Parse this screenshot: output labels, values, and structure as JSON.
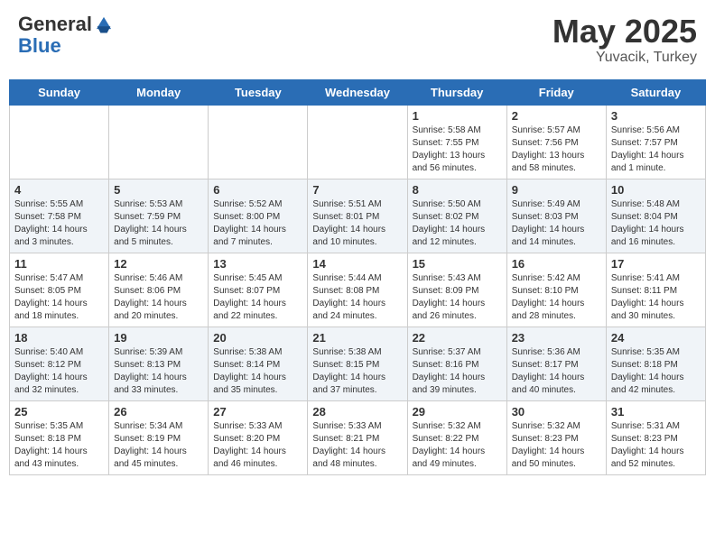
{
  "header": {
    "logo_general": "General",
    "logo_blue": "Blue",
    "month_year": "May 2025",
    "location": "Yuvacik, Turkey"
  },
  "weekdays": [
    "Sunday",
    "Monday",
    "Tuesday",
    "Wednesday",
    "Thursday",
    "Friday",
    "Saturday"
  ],
  "weeks": [
    [
      {
        "day": "",
        "info": ""
      },
      {
        "day": "",
        "info": ""
      },
      {
        "day": "",
        "info": ""
      },
      {
        "day": "",
        "info": ""
      },
      {
        "day": "1",
        "info": "Sunrise: 5:58 AM\nSunset: 7:55 PM\nDaylight: 13 hours\nand 56 minutes."
      },
      {
        "day": "2",
        "info": "Sunrise: 5:57 AM\nSunset: 7:56 PM\nDaylight: 13 hours\nand 58 minutes."
      },
      {
        "day": "3",
        "info": "Sunrise: 5:56 AM\nSunset: 7:57 PM\nDaylight: 14 hours\nand 1 minute."
      }
    ],
    [
      {
        "day": "4",
        "info": "Sunrise: 5:55 AM\nSunset: 7:58 PM\nDaylight: 14 hours\nand 3 minutes."
      },
      {
        "day": "5",
        "info": "Sunrise: 5:53 AM\nSunset: 7:59 PM\nDaylight: 14 hours\nand 5 minutes."
      },
      {
        "day": "6",
        "info": "Sunrise: 5:52 AM\nSunset: 8:00 PM\nDaylight: 14 hours\nand 7 minutes."
      },
      {
        "day": "7",
        "info": "Sunrise: 5:51 AM\nSunset: 8:01 PM\nDaylight: 14 hours\nand 10 minutes."
      },
      {
        "day": "8",
        "info": "Sunrise: 5:50 AM\nSunset: 8:02 PM\nDaylight: 14 hours\nand 12 minutes."
      },
      {
        "day": "9",
        "info": "Sunrise: 5:49 AM\nSunset: 8:03 PM\nDaylight: 14 hours\nand 14 minutes."
      },
      {
        "day": "10",
        "info": "Sunrise: 5:48 AM\nSunset: 8:04 PM\nDaylight: 14 hours\nand 16 minutes."
      }
    ],
    [
      {
        "day": "11",
        "info": "Sunrise: 5:47 AM\nSunset: 8:05 PM\nDaylight: 14 hours\nand 18 minutes."
      },
      {
        "day": "12",
        "info": "Sunrise: 5:46 AM\nSunset: 8:06 PM\nDaylight: 14 hours\nand 20 minutes."
      },
      {
        "day": "13",
        "info": "Sunrise: 5:45 AM\nSunset: 8:07 PM\nDaylight: 14 hours\nand 22 minutes."
      },
      {
        "day": "14",
        "info": "Sunrise: 5:44 AM\nSunset: 8:08 PM\nDaylight: 14 hours\nand 24 minutes."
      },
      {
        "day": "15",
        "info": "Sunrise: 5:43 AM\nSunset: 8:09 PM\nDaylight: 14 hours\nand 26 minutes."
      },
      {
        "day": "16",
        "info": "Sunrise: 5:42 AM\nSunset: 8:10 PM\nDaylight: 14 hours\nand 28 minutes."
      },
      {
        "day": "17",
        "info": "Sunrise: 5:41 AM\nSunset: 8:11 PM\nDaylight: 14 hours\nand 30 minutes."
      }
    ],
    [
      {
        "day": "18",
        "info": "Sunrise: 5:40 AM\nSunset: 8:12 PM\nDaylight: 14 hours\nand 32 minutes."
      },
      {
        "day": "19",
        "info": "Sunrise: 5:39 AM\nSunset: 8:13 PM\nDaylight: 14 hours\nand 33 minutes."
      },
      {
        "day": "20",
        "info": "Sunrise: 5:38 AM\nSunset: 8:14 PM\nDaylight: 14 hours\nand 35 minutes."
      },
      {
        "day": "21",
        "info": "Sunrise: 5:38 AM\nSunset: 8:15 PM\nDaylight: 14 hours\nand 37 minutes."
      },
      {
        "day": "22",
        "info": "Sunrise: 5:37 AM\nSunset: 8:16 PM\nDaylight: 14 hours\nand 39 minutes."
      },
      {
        "day": "23",
        "info": "Sunrise: 5:36 AM\nSunset: 8:17 PM\nDaylight: 14 hours\nand 40 minutes."
      },
      {
        "day": "24",
        "info": "Sunrise: 5:35 AM\nSunset: 8:18 PM\nDaylight: 14 hours\nand 42 minutes."
      }
    ],
    [
      {
        "day": "25",
        "info": "Sunrise: 5:35 AM\nSunset: 8:18 PM\nDaylight: 14 hours\nand 43 minutes."
      },
      {
        "day": "26",
        "info": "Sunrise: 5:34 AM\nSunset: 8:19 PM\nDaylight: 14 hours\nand 45 minutes."
      },
      {
        "day": "27",
        "info": "Sunrise: 5:33 AM\nSunset: 8:20 PM\nDaylight: 14 hours\nand 46 minutes."
      },
      {
        "day": "28",
        "info": "Sunrise: 5:33 AM\nSunset: 8:21 PM\nDaylight: 14 hours\nand 48 minutes."
      },
      {
        "day": "29",
        "info": "Sunrise: 5:32 AM\nSunset: 8:22 PM\nDaylight: 14 hours\nand 49 minutes."
      },
      {
        "day": "30",
        "info": "Sunrise: 5:32 AM\nSunset: 8:23 PM\nDaylight: 14 hours\nand 50 minutes."
      },
      {
        "day": "31",
        "info": "Sunrise: 5:31 AM\nSunset: 8:23 PM\nDaylight: 14 hours\nand 52 minutes."
      }
    ]
  ]
}
